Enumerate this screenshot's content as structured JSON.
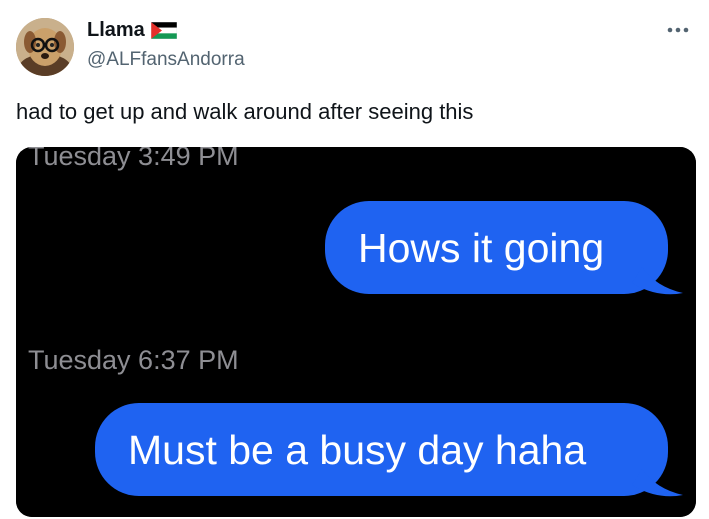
{
  "author": {
    "display_name": "Llama",
    "handle": "@ALFfansAndorra",
    "flag_icon": "palestine-flag-icon",
    "avatar_icon": "dog-with-glasses-avatar"
  },
  "tweet": {
    "text": "had to get up and walk around after seeing this"
  },
  "more_icon": "more-horizontal-icon",
  "screenshot": {
    "messages": [
      {
        "timestamp": "Tuesday 3:49 PM",
        "text": "Hows it going"
      },
      {
        "timestamp": "Tuesday 6:37 PM",
        "text": "Must be a busy day haha"
      }
    ],
    "colors": {
      "bubble": "#1f63f1",
      "background": "#000000",
      "timestamp": "#8e8e93"
    }
  }
}
